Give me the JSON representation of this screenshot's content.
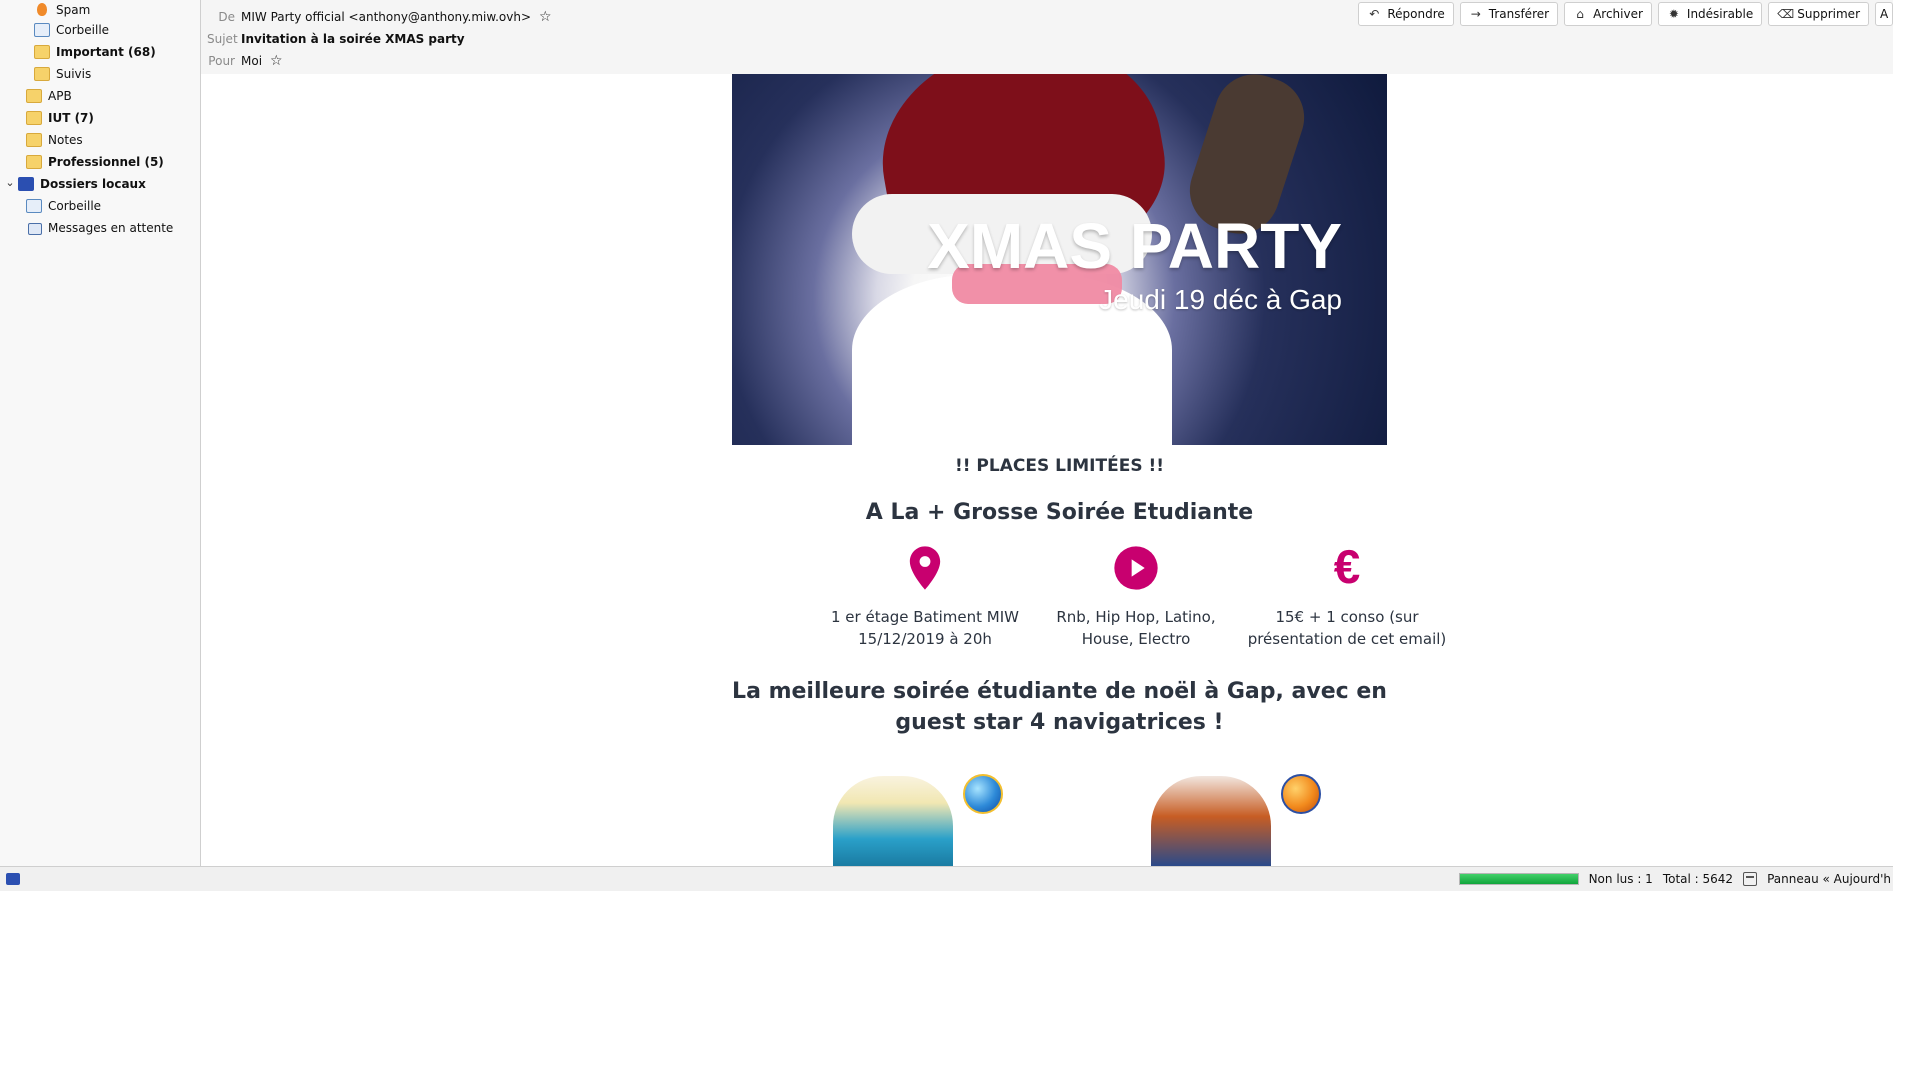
{
  "sidebar": {
    "items": [
      {
        "label": "Spam",
        "icon": "spam-icon",
        "bold": false
      },
      {
        "label": "Corbeille",
        "icon": "trash-icon",
        "bold": false
      },
      {
        "label": "Important (68)",
        "icon": "folder-icon",
        "bold": true
      },
      {
        "label": "Suivis",
        "icon": "folder-icon",
        "bold": false
      },
      {
        "label": "APB",
        "icon": "folder-icon",
        "bold": false
      },
      {
        "label": "IUT (7)",
        "icon": "folder-icon",
        "bold": true
      },
      {
        "label": "Notes",
        "icon": "folder-icon",
        "bold": false
      },
      {
        "label": "Professionnel (5)",
        "icon": "folder-icon",
        "bold": true
      },
      {
        "label": "Dossiers locaux",
        "icon": "local-folders-icon",
        "bold": true
      },
      {
        "label": "Corbeille",
        "icon": "trash-icon",
        "bold": false
      },
      {
        "label": "Messages en attente",
        "icon": "outbox-icon",
        "bold": false
      }
    ]
  },
  "header": {
    "from_key": "De",
    "from_value": "MIW Party official <anthony@anthony.miw.ovh>",
    "subject_key": "Sujet",
    "subject_value": "Invitation à la soirée XMAS party",
    "to_key": "Pour",
    "to_value": "Moi"
  },
  "toolbar": {
    "buttons": [
      {
        "label": "Répondre",
        "icon": "reply-icon",
        "glyph": "↶"
      },
      {
        "label": "Transférer",
        "icon": "forward-icon",
        "glyph": "→"
      },
      {
        "label": "Archiver",
        "icon": "archive-icon",
        "glyph": "⌂"
      },
      {
        "label": "Indésirable",
        "icon": "junk-icon",
        "glyph": "🔥"
      },
      {
        "label": "Supprimer",
        "icon": "delete-icon",
        "glyph": "🗑"
      },
      {
        "label": "A",
        "icon": "more-icon",
        "glyph": ""
      }
    ]
  },
  "email": {
    "hero_title": "XMAS PARTY",
    "hero_subtitle": "Jeudi 19 déc à Gap",
    "places": "!! PLACES LIMITÉES !!",
    "headline": "A La + Grosse Soirée Etudiante",
    "features": [
      {
        "icon": "location-icon",
        "text": "1 er étage Batiment MIW\n15/12/2019 à 20h"
      },
      {
        "icon": "play-icon",
        "text": "Rnb, Hip Hop, Latino,\nHouse, Electro"
      },
      {
        "icon": "euro-icon",
        "text": "15€ + 1 conso (sur\nprésentation de cet email)"
      }
    ],
    "bigline": "La meilleure soirée étudiante de noël à Gap, avec en guest star 4 navigatrices !",
    "promos": [
      {
        "logo": "internet-explorer-logo-icon"
      },
      {
        "logo": "firefox-logo-icon"
      }
    ]
  },
  "status": {
    "unread": "Non lus : 1",
    "total": "Total : 5642",
    "panel": "Panneau « Aujourd'h",
    "progress": 1.0
  },
  "colors": {
    "accent_magenta": "#c8006f",
    "progress_green": "#10a53b"
  }
}
